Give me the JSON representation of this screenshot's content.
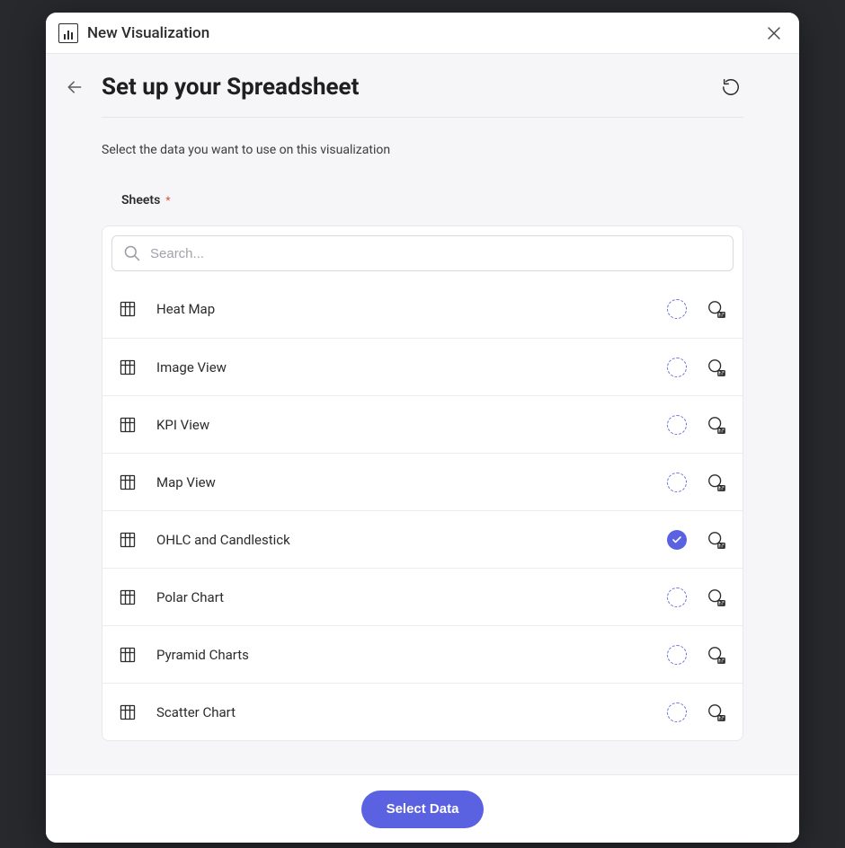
{
  "modal": {
    "title": "New Visualization"
  },
  "page": {
    "title": "Set up your Spreadsheet",
    "subtitle": "Select the data you want to use on this visualization"
  },
  "sheets": {
    "label": "Sheets",
    "search_placeholder": "Search...",
    "items": [
      {
        "name": "Heat Map",
        "selected": false
      },
      {
        "name": "Image View",
        "selected": false
      },
      {
        "name": "KPI View",
        "selected": false
      },
      {
        "name": "Map View",
        "selected": false
      },
      {
        "name": "OHLC and Candlestick",
        "selected": true
      },
      {
        "name": "Polar Chart",
        "selected": false
      },
      {
        "name": "Pyramid Charts",
        "selected": false
      },
      {
        "name": "Scatter Chart",
        "selected": false
      }
    ]
  },
  "footer": {
    "select_button": "Select Data"
  }
}
